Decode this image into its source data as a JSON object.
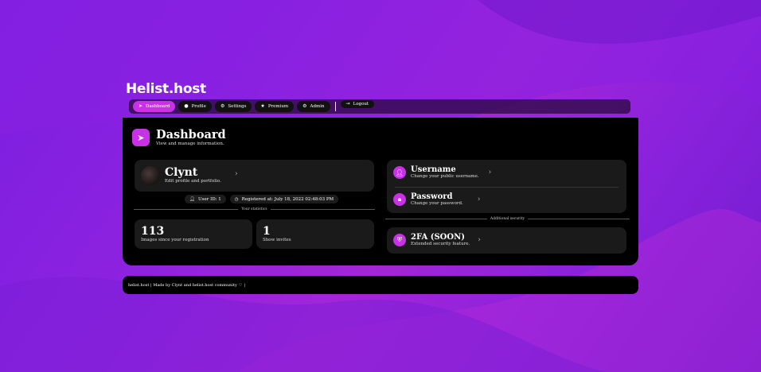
{
  "brand": "Helist.host",
  "nav": [
    {
      "label": "Dashboard",
      "icon": "paper-plane-icon",
      "glyph": "➤",
      "active": true
    },
    {
      "label": "Profile",
      "icon": "user-circle-icon",
      "glyph": "●",
      "active": false
    },
    {
      "label": "Settings",
      "icon": "gears-icon",
      "glyph": "⚙",
      "active": false
    },
    {
      "label": "Premium",
      "icon": "star-icon",
      "glyph": "★",
      "active": false
    },
    {
      "label": "Admin",
      "icon": "gears-icon",
      "glyph": "⚙",
      "active": false
    }
  ],
  "logout": {
    "label": "Logout",
    "icon": "logout-icon",
    "glyph": "⇥"
  },
  "header": {
    "title": "Dashboard",
    "subtitle": "View and manage information.",
    "icon": "paper-plane-icon"
  },
  "profile": {
    "name": "Clynt",
    "subtitle": "Edit profile and portfolio."
  },
  "badges": {
    "user_id": "User ID: 1",
    "registered": "Registered at: July 18, 2022 02:48:03 PM"
  },
  "statistics_divider": "Your statistics",
  "stats": [
    {
      "value": "113",
      "label": "Images since your registration"
    },
    {
      "value": "1",
      "label": "Show invites"
    }
  ],
  "security": [
    {
      "title": "Username",
      "subtitle": "Change your public username.",
      "icon": "user-icon"
    },
    {
      "title": "Password",
      "subtitle": "Change your password.",
      "icon": "lock-icon"
    }
  ],
  "additional_divider": "Additional security",
  "twofa": {
    "title": "2FA (SOON)",
    "subtitle": "Extended security feature.",
    "icon": "shield-icon"
  },
  "footer": {
    "text": "helist.host | Made by Clynt and helist.host community",
    "heart": "♡",
    "end": "|"
  },
  "colors": {
    "accent": "#c931e6",
    "panel": "#000000",
    "card": "#1a1a1a"
  }
}
